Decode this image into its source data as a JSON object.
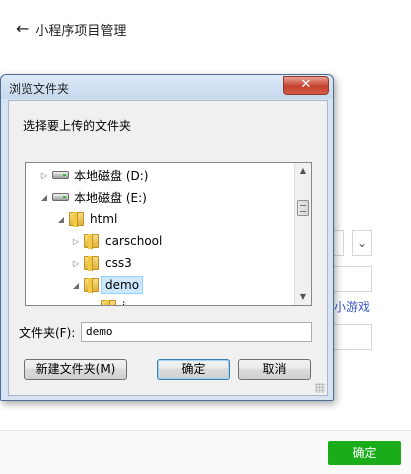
{
  "page": {
    "back_icon": "arrow-left-icon",
    "title": "小程序项目管理",
    "link_text": "小游戏",
    "confirm_label": "确定",
    "chevron_glyph": "⌄"
  },
  "dialog": {
    "title": "浏览文件夹",
    "close_glyph": "✕",
    "prompt": "选择要上传的文件夹",
    "tree": [
      {
        "label": "本地磁盘 (D:)",
        "type": "drive",
        "expander": "▷"
      },
      {
        "label": "本地磁盘 (E:)",
        "type": "drive",
        "expander": "◢"
      },
      {
        "label": "html",
        "type": "folder",
        "expander": "◢"
      },
      {
        "label": "carschool",
        "type": "folder",
        "expander": "▷"
      },
      {
        "label": "css3",
        "type": "folder",
        "expander": "▷"
      },
      {
        "label": "demo",
        "type": "folder",
        "expander": "◢",
        "selected": true
      },
      {
        "label": "i",
        "type": "folder",
        "expander": ""
      }
    ],
    "scroll_up": "▲",
    "scroll_down": "▼",
    "folder_label": "文件夹(F):",
    "folder_value": "demo",
    "new_folder_button": "新建文件夹(M)",
    "ok_button": "确定",
    "cancel_button": "取消"
  }
}
